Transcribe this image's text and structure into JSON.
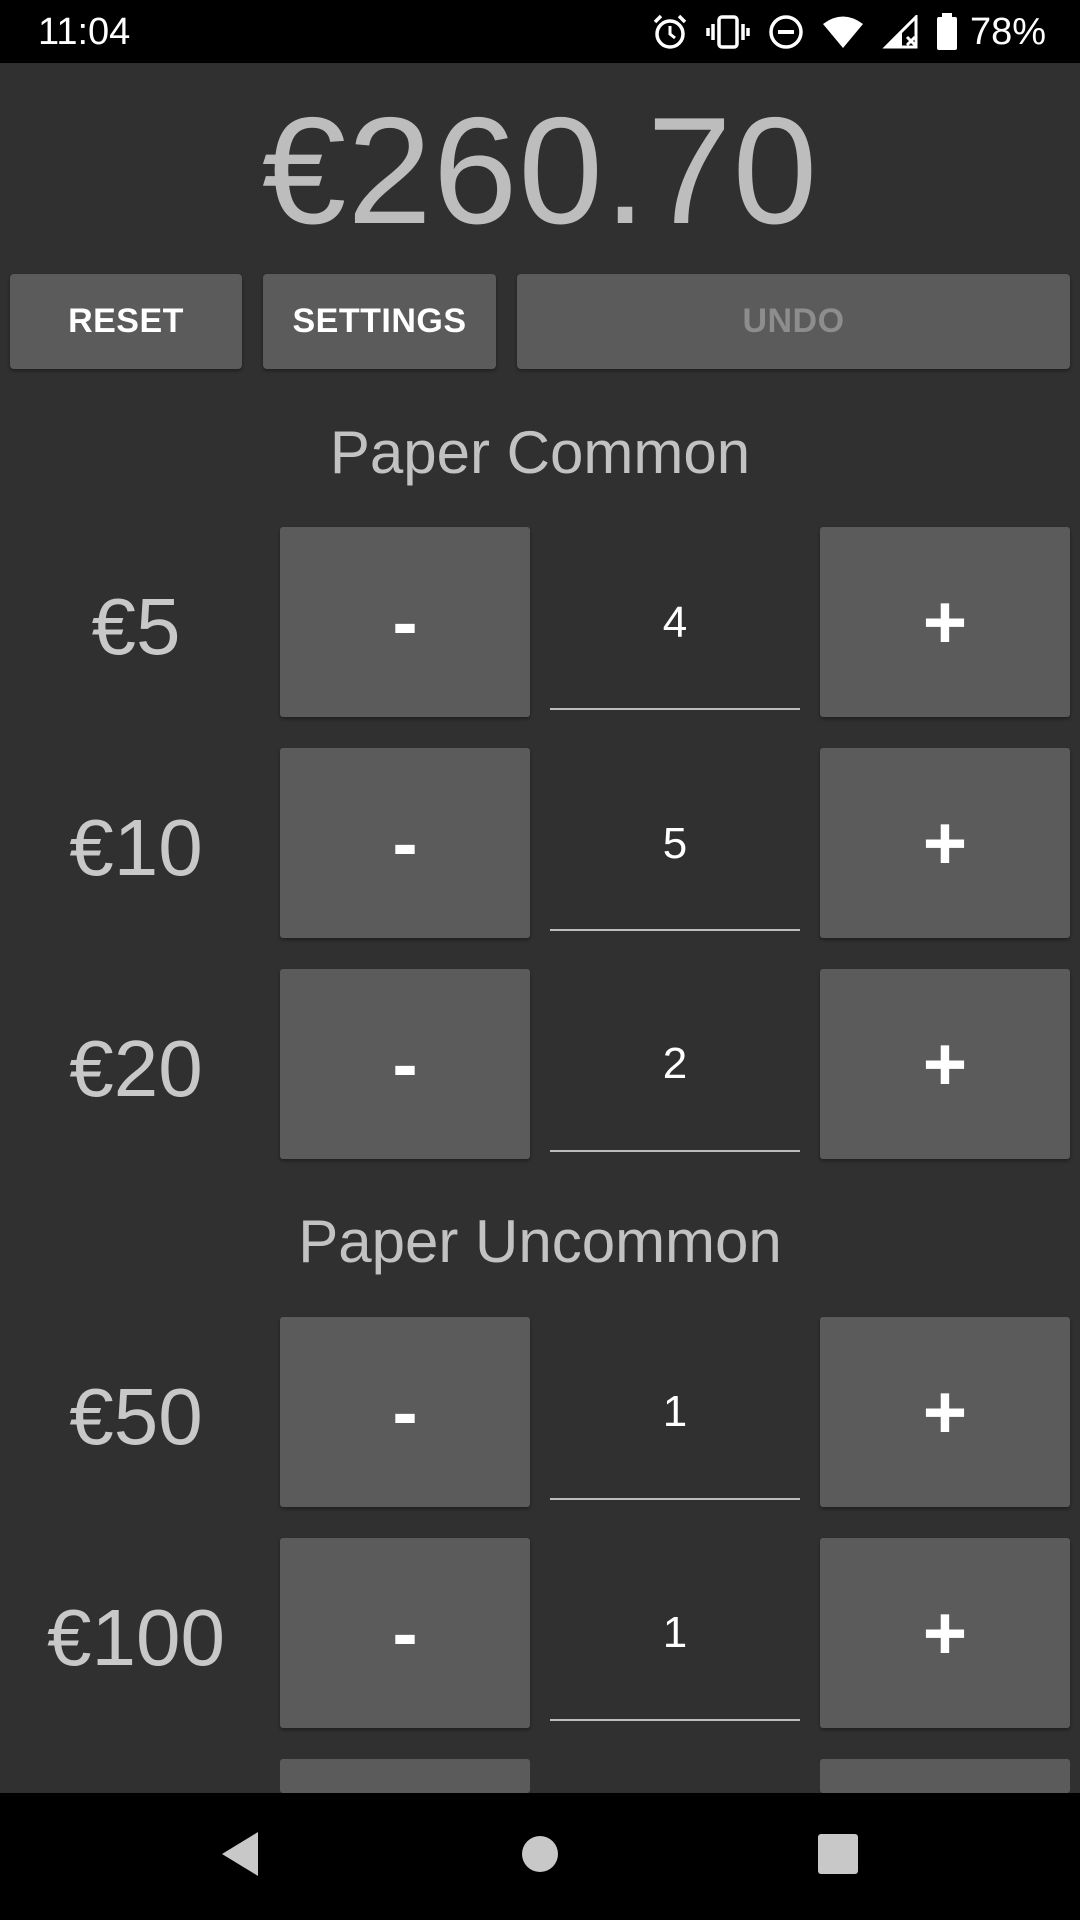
{
  "status_bar": {
    "time": "11:04",
    "battery_percent": "78%",
    "icons": [
      "alarm-icon",
      "vibrate-icon",
      "do-not-disturb-icon",
      "wifi-icon",
      "cell-signal-icon",
      "battery-icon"
    ]
  },
  "total": "€260.70",
  "toolbar": {
    "reset_label": "RESET",
    "settings_label": "SETTINGS",
    "undo_label": "UNDO"
  },
  "sections": [
    {
      "title": "Paper Common",
      "rows": [
        {
          "denomination": "€5",
          "minus": "-",
          "quantity": "4",
          "plus": "+"
        },
        {
          "denomination": "€10",
          "minus": "-",
          "quantity": "5",
          "plus": "+"
        },
        {
          "denomination": "€20",
          "minus": "-",
          "quantity": "2",
          "plus": "+"
        }
      ]
    },
    {
      "title": "Paper Uncommon",
      "rows": [
        {
          "denomination": "€50",
          "minus": "-",
          "quantity": "1",
          "plus": "+"
        },
        {
          "denomination": "€100",
          "minus": "-",
          "quantity": "1",
          "plus": "+"
        }
      ]
    }
  ],
  "navigation": [
    "back-icon",
    "home-icon",
    "recents-icon"
  ],
  "colors": {
    "background": "#303030",
    "button": "#5b5b5c",
    "text_muted": "#bdbdbd",
    "disabled_text": "#8d8d8d"
  }
}
